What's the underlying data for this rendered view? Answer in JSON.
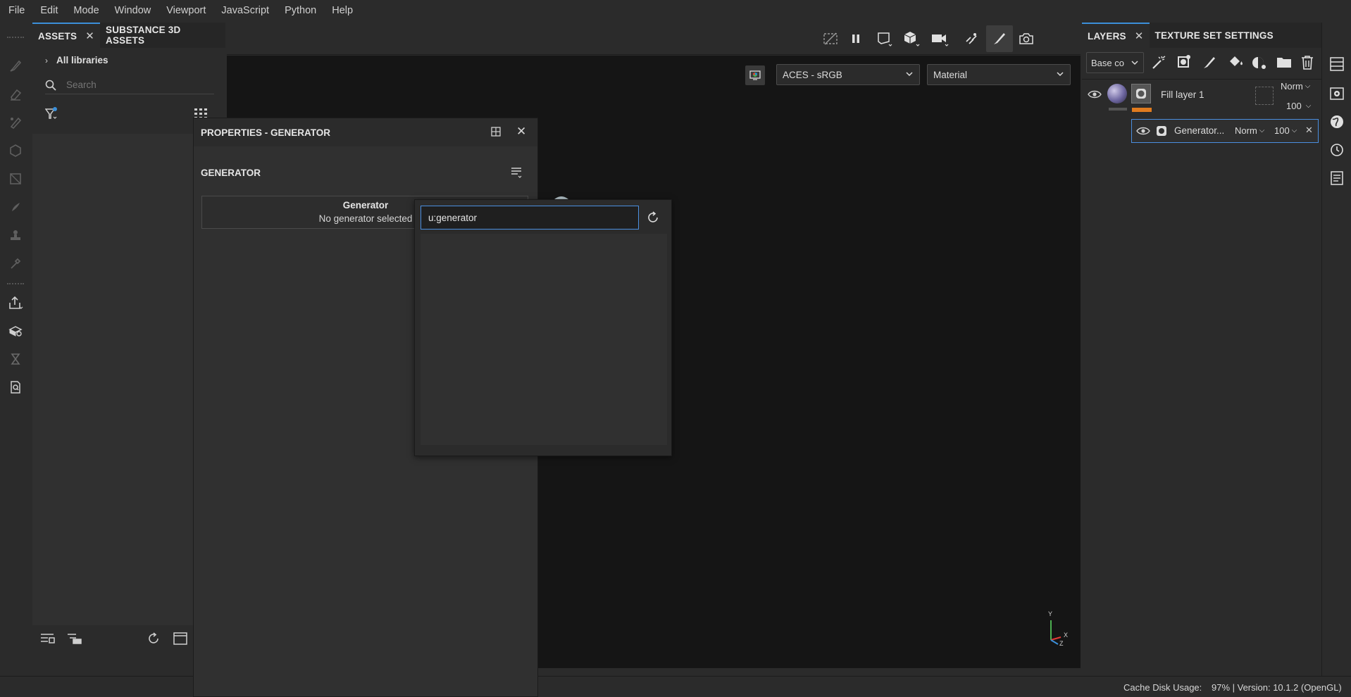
{
  "menu": [
    "File",
    "Edit",
    "Mode",
    "Window",
    "Viewport",
    "JavaScript",
    "Python",
    "Help"
  ],
  "assets_panel": {
    "tabs": [
      {
        "label": "ASSETS",
        "closable": true
      },
      {
        "label": "SUBSTANCE 3D ASSETS",
        "closable": false
      }
    ],
    "library": "All libraries",
    "search_placeholder": "Search"
  },
  "viewport": {
    "color_profile": "ACES - sRGB",
    "display_mode": "Material",
    "axes": {
      "y": "Y",
      "x": "X",
      "z": "Z"
    }
  },
  "properties": {
    "title": "PROPERTIES - GENERATOR",
    "section": "GENERATOR",
    "generator_label": "Generator",
    "generator_value": "No generator selected"
  },
  "search_popup": {
    "query": "u:generator"
  },
  "layers_panel": {
    "tabs": [
      {
        "label": "LAYERS",
        "closable": true
      },
      {
        "label": "TEXTURE SET SETTINGS",
        "closable": false
      }
    ],
    "channel": "Base co",
    "layers": [
      {
        "name": "Fill layer 1",
        "blend": "Norm",
        "opacity": "100"
      },
      {
        "name": "Generator...",
        "blend": "Norm",
        "opacity": "100"
      }
    ]
  },
  "status": {
    "cache_label": "Cache Disk Usage:",
    "cache_value": "97% | Version: 10.1.2 (OpenGL)"
  },
  "colors": {
    "accent": "#3b8fd9",
    "selection_border": "#4b8fe0",
    "fill_layer_bar": "#e07b1f"
  }
}
